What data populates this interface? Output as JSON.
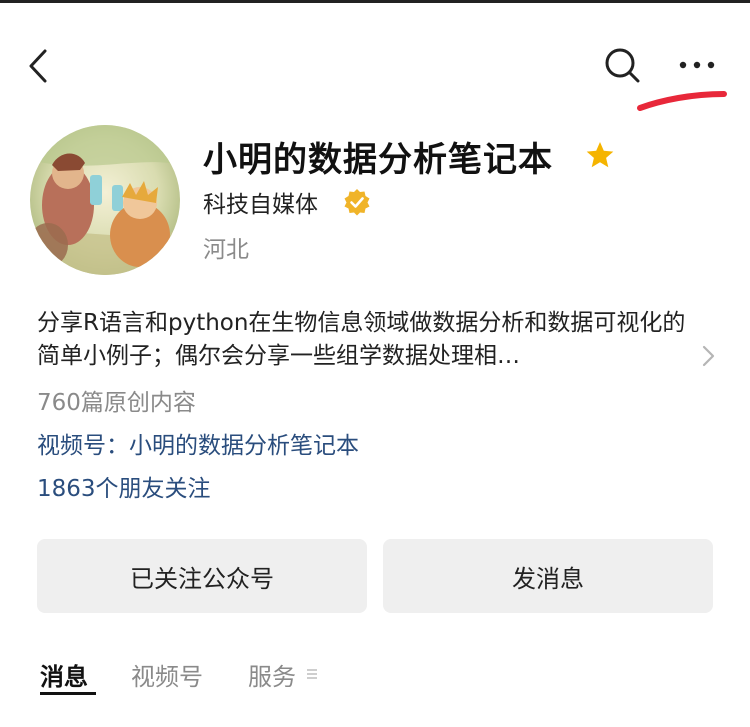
{
  "account": {
    "name": "小明的数据分析笔记本",
    "type": "科技自媒体",
    "location": "河北",
    "description": "分享R语言和python在生物信息领域做数据分析和数据可视化的简单小例子；偶尔会分享一些组学数据处理相…",
    "article_count": "760篇原创内容",
    "channel": "视频号：小明的数据分析笔记本",
    "friends_follow": "1863个朋友关注"
  },
  "buttons": {
    "followed": "已关注公众号",
    "message": "发消息"
  },
  "tabs": [
    {
      "label": "消息",
      "active": true
    },
    {
      "label": "视频号",
      "active": false
    },
    {
      "label": "服务",
      "active": false
    }
  ],
  "icons": {
    "back": "chevron-left-icon",
    "search": "search-icon",
    "more": "more-dots-icon",
    "star": "star-icon",
    "verified": "verified-badge-icon",
    "chevron": "chevron-right-icon",
    "menu": "menu-lines-icon"
  },
  "colors": {
    "link": "#2a4d7d",
    "star": "#f5b400",
    "verified": "#f0b429",
    "annotation": "#e8283a",
    "button_bg": "#efefef"
  }
}
